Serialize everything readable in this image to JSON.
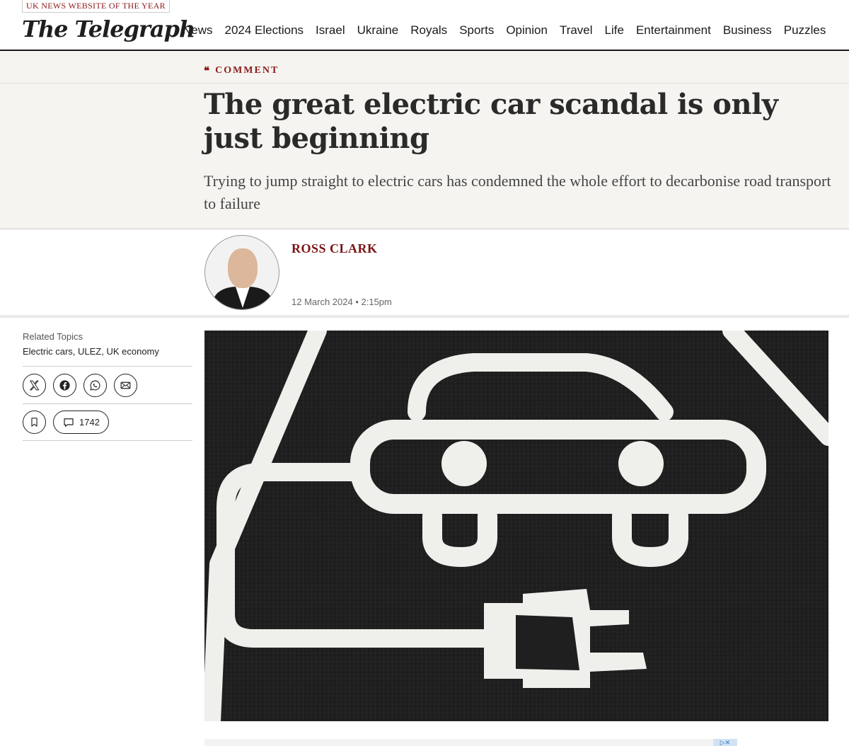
{
  "header": {
    "award": "UK NEWS WEBSITE OF THE YEAR",
    "logo": "The Telegraph",
    "nav": [
      "News",
      "2024 Elections",
      "Israel",
      "Ukraine",
      "Royals",
      "Sports",
      "Opinion",
      "Travel",
      "Life",
      "Entertainment",
      "Business",
      "Puzzles"
    ]
  },
  "article": {
    "kicker": "COMMENT",
    "kicker_icon": "quote-icon",
    "headline": "The great electric car scandal is only just beginning",
    "standfirst": "Trying to jump straight to electric cars has condemned the whole effort to decarbonise road transport to failure",
    "author": "ROSS CLARK",
    "date": "12 March 2024 • 2:15pm"
  },
  "sidebar": {
    "related_label": "Related Topics",
    "related_topics": "Electric cars, ULEZ, UK economy",
    "share_icons": [
      "x-icon",
      "facebook-icon",
      "whatsapp-icon",
      "email-icon"
    ],
    "comment_count": "1742"
  },
  "colors": {
    "accent": "#8a1b1b",
    "band_bg": "#f5f4f0",
    "asphalt": "#1e1e1e",
    "paint": "#f0f0ee"
  }
}
